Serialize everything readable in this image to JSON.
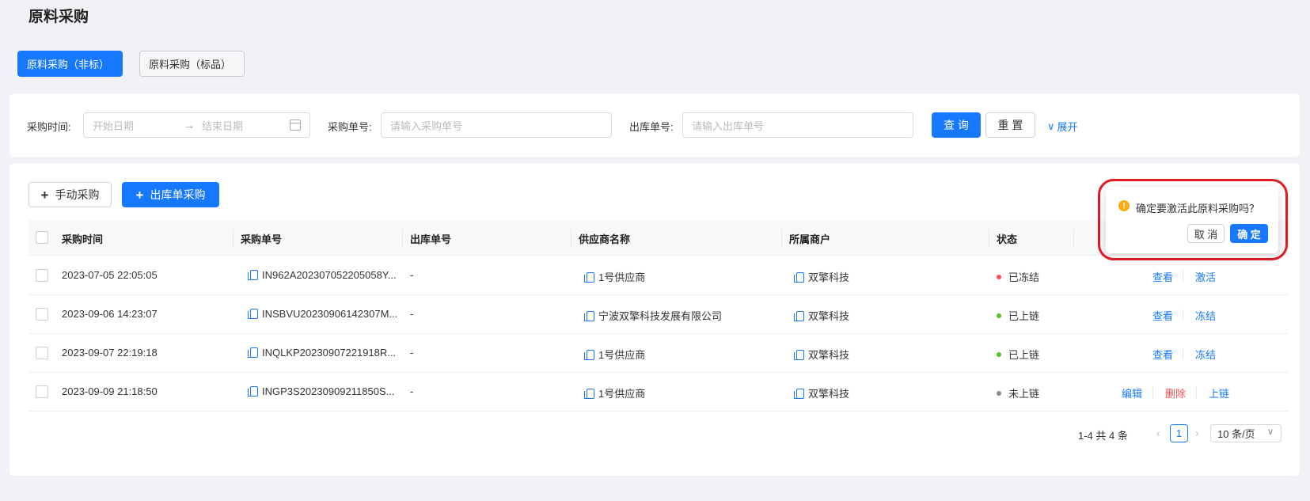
{
  "page": {
    "title": "原料采购"
  },
  "tabs": [
    {
      "label": "原料采购（非标）",
      "active": true
    },
    {
      "label": "原料采购（标品）",
      "active": false
    }
  ],
  "filters": {
    "purchase_time_label": "采购时间:",
    "start_placeholder": "开始日期",
    "end_placeholder": "结束日期",
    "order_no_label": "采购单号:",
    "order_no_placeholder": "请输入采购单号",
    "outbound_no_label": "出库单号:",
    "outbound_no_placeholder": "请输入出库单号",
    "query_label": "查 询",
    "reset_label": "重 置",
    "expand_label": "展开"
  },
  "toolbar": {
    "manual_label": "手动采购",
    "outbound_label": "出库单采购"
  },
  "table": {
    "columns": [
      "采购时间",
      "采购单号",
      "出库单号",
      "供应商名称",
      "所属商户",
      "状态"
    ],
    "rows": [
      {
        "time": "2023-07-05 22:05:05",
        "order_no": "IN962A202307052205058Y...",
        "outbound_no": "-",
        "supplier": "1号供应商",
        "merchant": "双擎科技",
        "status": "已冻结",
        "status_color": "#ff4d4f",
        "actions": [
          "查看",
          "激活"
        ]
      },
      {
        "time": "2023-09-06 14:23:07",
        "order_no": "INSBVU20230906142307M...",
        "outbound_no": "-",
        "supplier": "宁波双擎科技发展有限公司",
        "merchant": "双擎科技",
        "status": "已上链",
        "status_color": "#52c41a",
        "actions": [
          "查看",
          "冻结"
        ]
      },
      {
        "time": "2023-09-07 22:19:18",
        "order_no": "INQLKP20230907221918R...",
        "outbound_no": "-",
        "supplier": "1号供应商",
        "merchant": "双擎科技",
        "status": "已上链",
        "status_color": "#52c41a",
        "actions": [
          "查看",
          "冻结"
        ]
      },
      {
        "time": "2023-09-09 21:18:50",
        "order_no": "INGP3S20230909211850S...",
        "outbound_no": "-",
        "supplier": "1号供应商",
        "merchant": "双擎科技",
        "status": "未上链",
        "status_color": "#8c8c8c",
        "actions": [
          "编辑",
          "删除",
          "上链"
        ]
      }
    ]
  },
  "pagination": {
    "total_text": "1-4 共 4 条",
    "current_page": "1",
    "page_size": "10 条/页"
  },
  "popconfirm": {
    "message": "确定要激活此原料采购吗？",
    "cancel_label": "取 消",
    "ok_label": "确 定"
  },
  "colors": {
    "primary": "#1677ff",
    "danger": "#ff4d4f",
    "warning": "#faad14",
    "highlight": "#e01b24"
  }
}
